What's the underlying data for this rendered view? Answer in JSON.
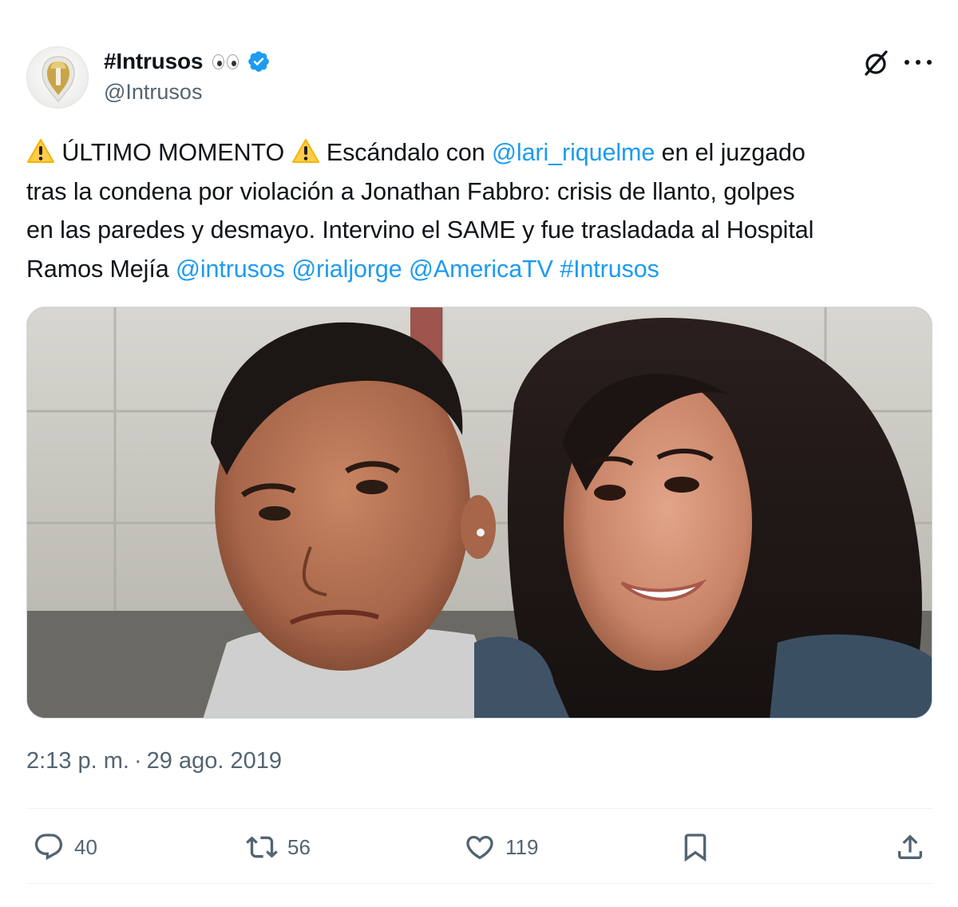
{
  "author": {
    "display_name": "#Intrusos",
    "handle": "@Intrusos",
    "verified": true,
    "icons": [
      "eyes-icon",
      "verified-badge-icon"
    ],
    "verified_color": "#1d9bf0"
  },
  "header_icons": [
    "grok-icon",
    "more-icon"
  ],
  "tweet": {
    "lines": [
      [
        {
          "type": "icon",
          "name": "warning-icon"
        },
        {
          "type": "text",
          "text": " ÚLTIMO MOMENTO "
        },
        {
          "type": "icon",
          "name": "warning-icon"
        },
        {
          "type": "text",
          "text": " Escándalo con "
        },
        {
          "type": "link",
          "text": "@lari_riquelme"
        },
        {
          "type": "text",
          "text": " en el juzgado"
        }
      ],
      [
        {
          "type": "text",
          "text": "tras la condena por violación a Jonathan Fabbro: crisis de llanto, golpes"
        }
      ],
      [
        {
          "type": "text",
          "text": "en las paredes y desmayo. Intervino el SAME y fue trasladada al Hospital"
        }
      ],
      [
        {
          "type": "text",
          "text": "Ramos Mejía "
        },
        {
          "type": "link",
          "text": "@intrusos"
        },
        {
          "type": "text",
          "text": " "
        },
        {
          "type": "link",
          "text": "@rialjorge"
        },
        {
          "type": "text",
          "text": " "
        },
        {
          "type": "link",
          "text": "@AmericaTV"
        },
        {
          "type": "text",
          "text": " "
        },
        {
          "type": "link",
          "text": "#Intrusos"
        }
      ]
    ],
    "link_color": "#1d9bf0"
  },
  "timestamp": {
    "time": "2:13 p. m.",
    "separator": "·",
    "date": "29 ago. 2019"
  },
  "actions": {
    "reply": {
      "icon": "reply-icon",
      "count": "40"
    },
    "retweet": {
      "icon": "retweet-icon",
      "count": "56"
    },
    "like": {
      "icon": "heart-icon",
      "count": "119"
    },
    "bookmark": {
      "icon": "bookmark-icon"
    },
    "share": {
      "icon": "share-icon"
    }
  }
}
